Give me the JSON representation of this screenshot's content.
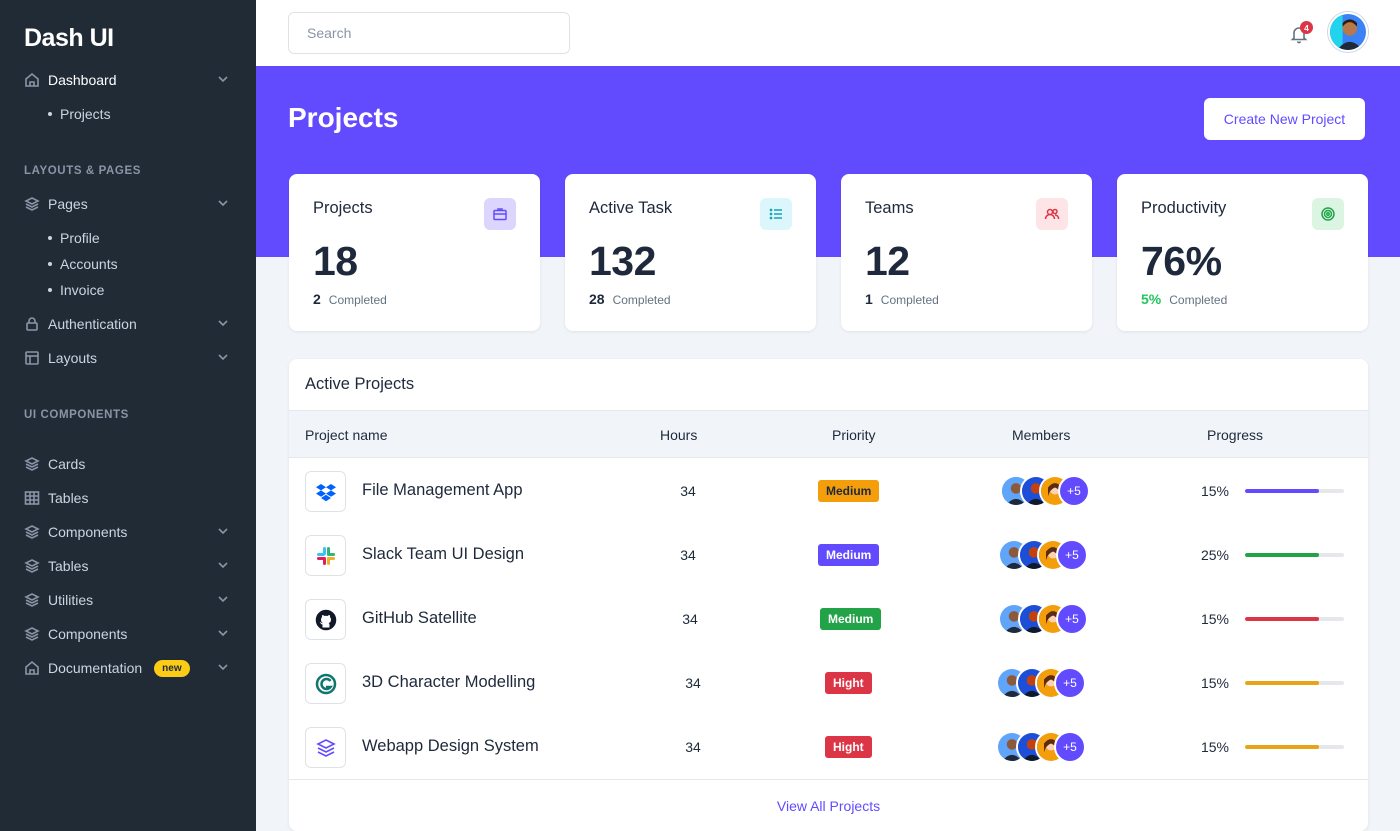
{
  "brand": "Dash UI",
  "sidebar": {
    "dashboard": "Dashboard",
    "projects": "Projects",
    "section_layouts": "LAYOUTS & PAGES",
    "pages": "Pages",
    "profile": "Profile",
    "accounts": "Accounts",
    "invoice": "Invoice",
    "authentication": "Authentication",
    "layouts": "Layouts",
    "section_components": "UI COMPONENTS",
    "cards": "Cards",
    "tables": "Tables",
    "components": "Components",
    "tables2": "Tables",
    "utilities": "Utilities",
    "components2": "Components",
    "documentation": "Documentation",
    "new_badge": "new"
  },
  "header": {
    "search_placeholder": "Search",
    "notification_count": "4",
    "avatar_icon": "user-avatar"
  },
  "hero": {
    "title": "Projects",
    "create_label": "Create New Project",
    "background": "#624bff"
  },
  "stats": [
    {
      "title": "Projects",
      "value": "18",
      "count": "2",
      "label": "Completed",
      "icon": "briefcase-icon"
    },
    {
      "title": "Active Task",
      "value": "132",
      "count": "28",
      "label": "Completed",
      "icon": "list-icon"
    },
    {
      "title": "Teams",
      "value": "12",
      "count": "1",
      "label": "Completed",
      "icon": "users-icon"
    },
    {
      "title": "Productivity",
      "value": "76%",
      "count": "5%",
      "label": "Completed",
      "icon": "target-icon"
    }
  ],
  "projects_table": {
    "title": "Active Projects",
    "columns": [
      "Project name",
      "Hours",
      "Priority",
      "Members",
      "Progress"
    ],
    "rows": [
      {
        "name": "File Management App",
        "hours": "34",
        "priority": "Medium",
        "priority_color": "#f59e0b",
        "members_more": "+5",
        "progress": "15%",
        "progress_value": 0.15,
        "bar_color": "#624bff",
        "icon": "dropbox-icon"
      },
      {
        "name": "Slack Team UI Design",
        "hours": "34",
        "priority": "Medium",
        "priority_color": "#624bff",
        "members_more": "+5",
        "progress": "25%",
        "progress_value": 0.25,
        "bar_color": "#22a348",
        "icon": "slack-icon"
      },
      {
        "name": "GitHub Satellite",
        "hours": "34",
        "priority": "Medium",
        "priority_color": "#22a348",
        "members_more": "+5",
        "progress": "15%",
        "progress_value": 0.15,
        "bar_color": "#dc3545",
        "icon": "github-icon"
      },
      {
        "name": "3D Character Modelling",
        "hours": "34",
        "priority": "Hight",
        "priority_color": "#dc3545",
        "members_more": "+5",
        "progress": "15%",
        "progress_value": 0.15,
        "bar_color": "#e8a317",
        "icon": "3d-logo-icon"
      },
      {
        "name": "Webapp Design System",
        "hours": "34",
        "priority": "Hight",
        "priority_color": "#dc3545",
        "members_more": "+5",
        "progress": "15%",
        "progress_value": 0.15,
        "bar_color": "#e8a317",
        "icon": "layers-icon"
      }
    ],
    "view_all": "View All Projects"
  }
}
